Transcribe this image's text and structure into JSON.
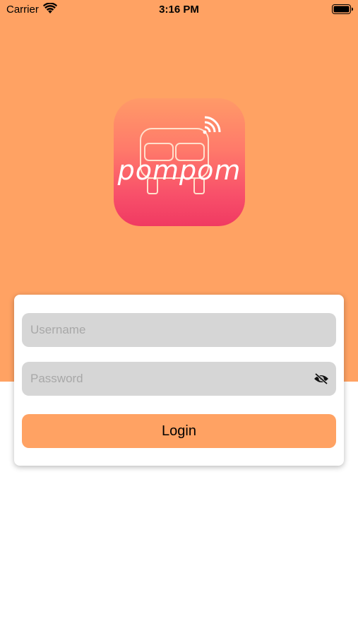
{
  "status_bar": {
    "carrier": "Carrier",
    "time": "3:16 PM"
  },
  "logo": {
    "text": "pompom"
  },
  "login_form": {
    "username_placeholder": "Username",
    "username_value": "",
    "password_placeholder": "Password",
    "password_value": "",
    "login_label": "Login"
  },
  "colors": {
    "accent": "#ffa263",
    "field_background": "#d6d6d6",
    "logo_gradient_top": "#ff9a68",
    "logo_gradient_bottom": "#f03a62"
  },
  "icons": {
    "wifi": "wifi-icon",
    "battery": "battery-icon",
    "password_toggle": "eye-slash-icon"
  }
}
